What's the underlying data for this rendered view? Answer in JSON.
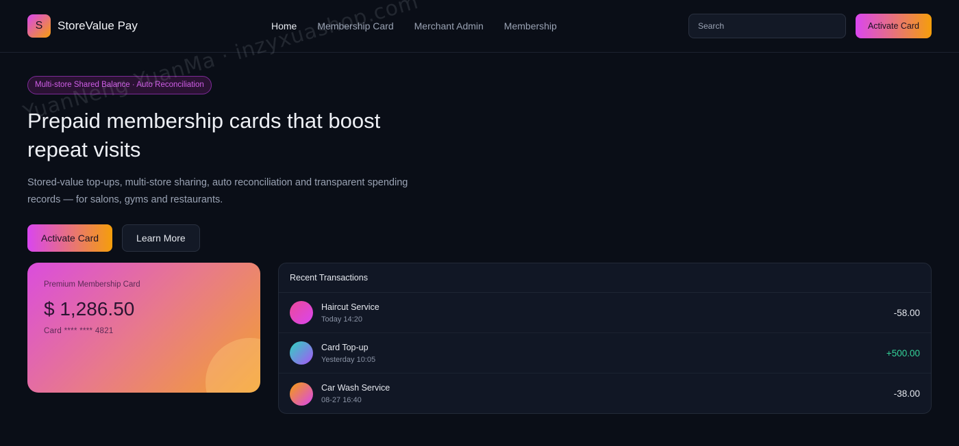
{
  "watermark": "YuanNeng YuanMa · inzyxuashop.com",
  "brand": {
    "logo_letter": "S",
    "name": "StoreValue Pay"
  },
  "nav": [
    {
      "label": "Home",
      "active": true
    },
    {
      "label": "Membership Card",
      "active": false
    },
    {
      "label": "Merchant Admin",
      "active": false
    },
    {
      "label": "Membership",
      "active": false
    }
  ],
  "header": {
    "search_placeholder": "Search",
    "activate_label": "Activate Card"
  },
  "hero": {
    "tag": "Multi-store Shared Balance · Auto Reconciliation",
    "title": "Prepaid membership cards that boost repeat visits",
    "description": "Stored-value top-ups, multi-store sharing, auto reconciliation and transparent spending records — for salons, gyms and restaurants.",
    "primary_label": "Activate Card",
    "secondary_label": "Learn More"
  },
  "card": {
    "label": "Premium Membership Card",
    "amount": "$ 1,286.50",
    "number": "Card **** **** 4821"
  },
  "transactions": {
    "title": "Recent Transactions",
    "items": [
      {
        "name": "Haircut Service",
        "time": "Today 14:20",
        "amount": "-58.00",
        "positive": false,
        "avatar": [
          "#ec4899",
          "#d946ef"
        ]
      },
      {
        "name": "Card Top-up",
        "time": "Yesterday 10:05",
        "amount": "+500.00",
        "positive": true,
        "avatar": [
          "#2dd4bf",
          "#a855f7"
        ]
      },
      {
        "name": "Car Wash Service",
        "time": "08-27 16:40",
        "amount": "-38.00",
        "positive": false,
        "avatar": [
          "#f59e0b",
          "#d946ef"
        ]
      }
    ]
  },
  "colors": {
    "background": "#0a0e17",
    "accent_start": "#d946ef",
    "accent_end": "#f59e0b",
    "positive": "#34d399"
  }
}
